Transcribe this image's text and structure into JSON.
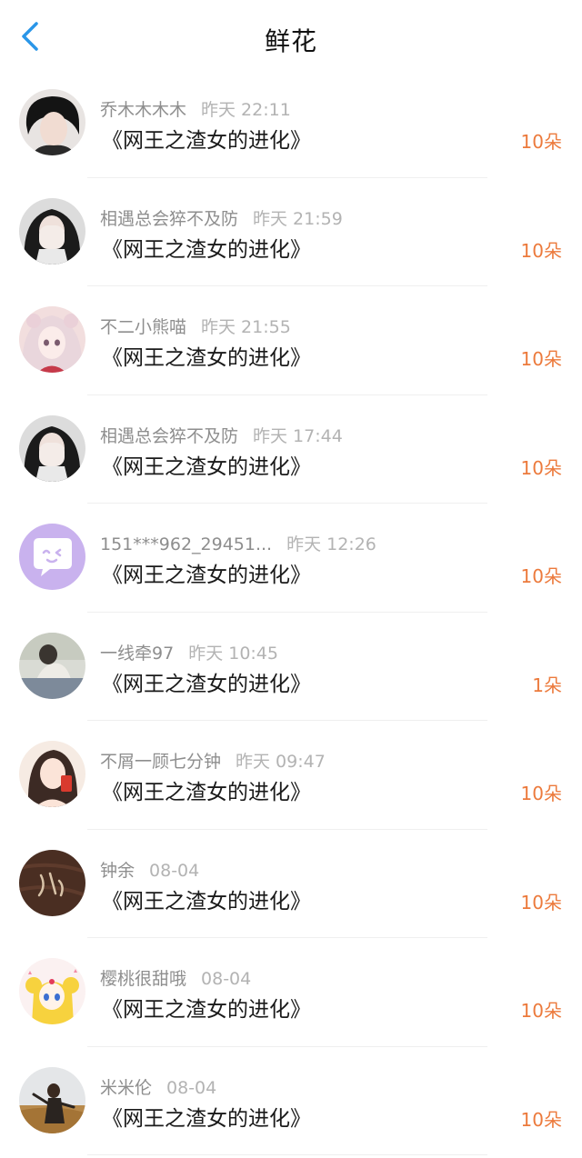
{
  "header": {
    "title": "鲜花",
    "back_icon": "chevron-left-icon"
  },
  "colors": {
    "accent_blue": "#2a96e8",
    "count_orange": "#ec7a3c",
    "username_gray": "#8e8e8e",
    "time_gray": "#b3b3b3"
  },
  "items": [
    {
      "username": "乔木木木木",
      "time": "昨天 22:11",
      "book": "《网王之渣女的进化》",
      "count": "10朵",
      "avatar": "avatar-photo-dark-hair"
    },
    {
      "username": "相遇总会猝不及防",
      "time": "昨天 21:59",
      "book": "《网王之渣女的进化》",
      "count": "10朵",
      "avatar": "avatar-photo-covering-face"
    },
    {
      "username": "不二小熊喵",
      "time": "昨天 21:55",
      "book": "《网王之渣女的进化》",
      "count": "10朵",
      "avatar": "avatar-anime-girl"
    },
    {
      "username": "相遇总会猝不及防",
      "time": "昨天 17:44",
      "book": "《网王之渣女的进化》",
      "count": "10朵",
      "avatar": "avatar-photo-covering-face"
    },
    {
      "username": "151***962_29451...",
      "time": "昨天 12:26",
      "book": "《网王之渣女的进化》",
      "count": "10朵",
      "avatar": "avatar-default-chat-bubble"
    },
    {
      "username": "一线牵97",
      "time": "昨天 10:45",
      "book": "《网王之渣女的进化》",
      "count": "1朵",
      "avatar": "avatar-photo-light"
    },
    {
      "username": "不屑一顾七分钟",
      "time": "昨天 09:47",
      "book": "《网王之渣女的进化》",
      "count": "10朵",
      "avatar": "avatar-illustrated-girl"
    },
    {
      "username": "钟余",
      "time": "08-04",
      "book": "《网王之渣女的进化》",
      "count": "10朵",
      "avatar": "avatar-wood-calligraphy"
    },
    {
      "username": "樱桃很甜哦",
      "time": "08-04",
      "book": "《网王之渣女的进化》",
      "count": "10朵",
      "avatar": "avatar-sailor-moon"
    },
    {
      "username": "米米伦",
      "time": "08-04",
      "book": "《网王之渣女的进化》",
      "count": "10朵",
      "avatar": "avatar-photo-field"
    }
  ]
}
